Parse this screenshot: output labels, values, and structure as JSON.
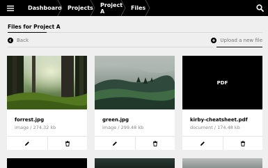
{
  "topbar": {
    "breadcrumbs": [
      "Dashboard",
      "Projects",
      "Project A",
      "Files"
    ],
    "menu_icon": "hamburger-icon",
    "search_icon": "search-icon"
  },
  "page": {
    "title": "Files for Project A",
    "back_label": "Back",
    "upload_label": "Upload a new file"
  },
  "files": [
    {
      "name": "forrest.jpg",
      "meta": "image / 274.32 kb",
      "thumb": "forest-photo"
    },
    {
      "name": "green.jpg",
      "meta": "image / 299.48 kb",
      "thumb": "green-hills-photo"
    },
    {
      "name": "kirby-cheatsheet.pdf",
      "meta": "document / 174.48 kb",
      "thumb": "pdf",
      "thumb_label": "PDF"
    }
  ],
  "colors": {
    "topbar": "#000000",
    "background": "#efefef",
    "card": "#ffffff",
    "muted": "#888888"
  }
}
